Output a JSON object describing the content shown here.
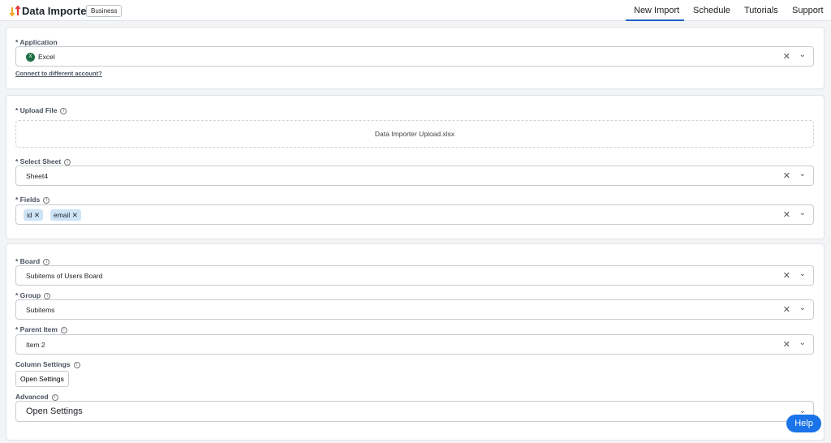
{
  "header": {
    "title": "Data Importer",
    "badge": "Business",
    "nav": [
      "New Import",
      "Schedule",
      "Tutorials",
      "Support"
    ]
  },
  "application": {
    "label": "* Application",
    "value": "Excel",
    "link": "Connect to different account?"
  },
  "upload": {
    "label": "* Upload File",
    "file": "Data Importer Upload.xlsx"
  },
  "sheet": {
    "label": "* Select Sheet",
    "value": "Sheet4"
  },
  "fields": {
    "label": "* Fields",
    "tags": [
      "id",
      "email"
    ]
  },
  "board": {
    "label": "* Board",
    "value": "Subitems of Users Board"
  },
  "group": {
    "label": "* Group",
    "value": "Subitems"
  },
  "parent": {
    "label": "* Parent Item",
    "value": "Item 2"
  },
  "column_settings": {
    "label": "Column Settings",
    "button": "Open Settings"
  },
  "advanced": {
    "label": "Advanced",
    "value": "Open Settings"
  },
  "help": "Help"
}
